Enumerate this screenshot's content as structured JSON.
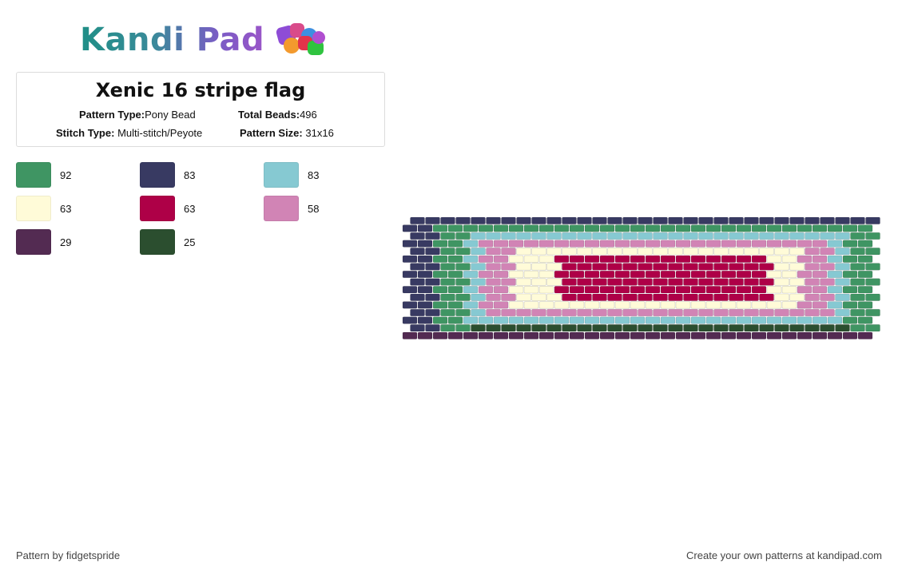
{
  "brand": {
    "logo_text": "Kandi Pad"
  },
  "pattern": {
    "title": "Xenic 16 stripe flag",
    "type_label": "Pattern Type:",
    "type_value": "Pony Bead",
    "beads_label": "Total Beads:",
    "beads_value": "496",
    "stitch_label": "Stitch Type:",
    "stitch_value": "Multi-stitch/Peyote",
    "size_label": "Pattern Size:",
    "size_value": "31x16"
  },
  "palette": [
    {
      "color": "#3f9563",
      "count": "92"
    },
    {
      "color": "#383a62",
      "count": "83"
    },
    {
      "color": "#86c9d2",
      "count": "83"
    },
    {
      "color": "#fffbd8",
      "count": "63"
    },
    {
      "color": "#ae0047",
      "count": "63"
    },
    {
      "color": "#d184b5",
      "count": "58"
    },
    {
      "color": "#532b52",
      "count": "29"
    },
    {
      "color": "#2b4e2f",
      "count": "25"
    }
  ],
  "footer": {
    "author": "Pattern by fidgetspride",
    "cta": "Create your own patterns at kandipad.com"
  }
}
